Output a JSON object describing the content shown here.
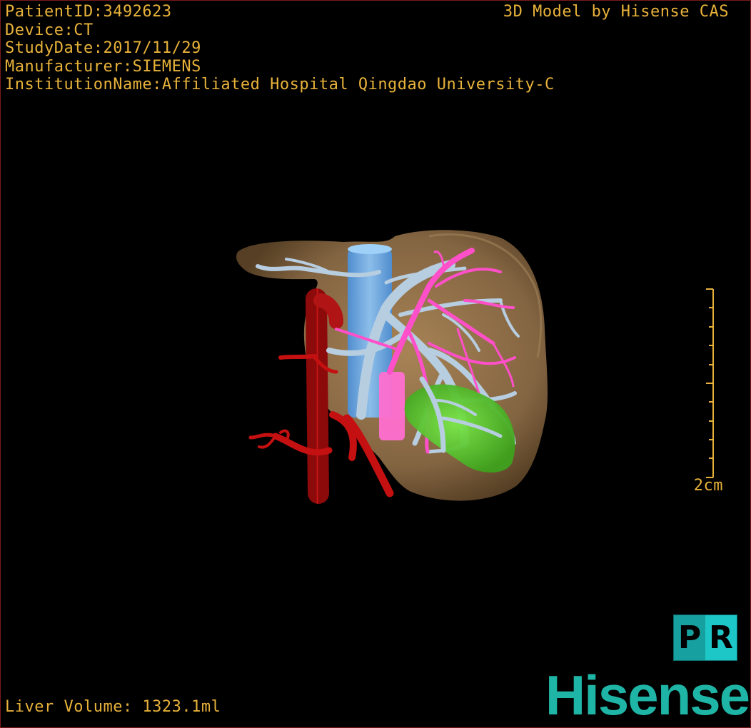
{
  "overlay": {
    "patient_id": "PatientID:3492623",
    "device": "Device:CT",
    "study_date": "StudyDate:2017/11/29",
    "manufacturer": "Manufacturer:SIEMENS",
    "institution": "InstitutionName:Affiliated Hospital Qingdao University-C",
    "product": "3D Model by Hisense CAS",
    "volume": "Liver Volume: 1323.1ml"
  },
  "scale": {
    "label": "2cm"
  },
  "badge": {
    "p": "P",
    "r": "R"
  },
  "brand": {
    "logo_text": "Hisense"
  },
  "colors": {
    "text": "#e8b23a",
    "liver": "#8a6a45",
    "portal_vein": "#b7cde0",
    "hepatic_vein": "#ff4fc9",
    "artery": "#c41010",
    "ivc": "#6aa8e8",
    "gallbladder": "#5ed12f",
    "brand": "#1fb5a6"
  },
  "structures": [
    {
      "name": "liver",
      "label_icon": "liver-surface"
    },
    {
      "name": "inferior-vena-cava",
      "label_icon": "vein-cylinder"
    },
    {
      "name": "hepatic-artery",
      "label_icon": "artery-tree"
    },
    {
      "name": "portal-vein",
      "label_icon": "vessel-tree"
    },
    {
      "name": "hepatic-vein",
      "label_icon": "vessel-tree"
    },
    {
      "name": "gallbladder",
      "label_icon": "organ-blob"
    }
  ]
}
